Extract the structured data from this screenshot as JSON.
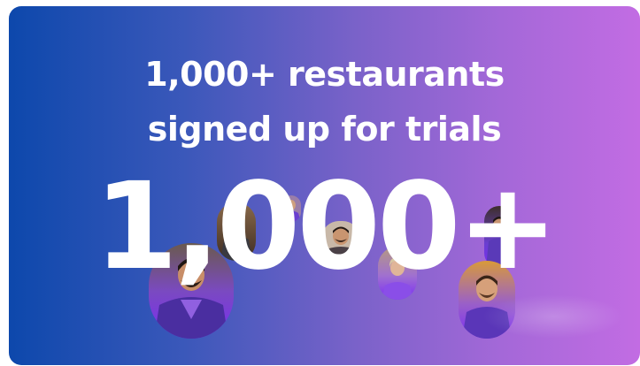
{
  "card": {
    "headline_line1": "1,000+ restaurants",
    "headline_line2": "signed up for trials",
    "big_number": "1,000+"
  },
  "colors": {
    "gradient_start": "#0d48ac",
    "gradient_end": "#c26ce3",
    "text": "#ffffff",
    "photo_tint": "#7a2cf5"
  },
  "photos": [
    {
      "name": "restaurant-owner-photo-1",
      "shape": "oval"
    },
    {
      "name": "restaurant-owner-photo-2",
      "shape": "oval"
    },
    {
      "name": "restaurant-owner-photo-3",
      "shape": "oval"
    },
    {
      "name": "restaurant-owner-photo-4",
      "shape": "circle"
    },
    {
      "name": "restaurant-owner-photo-5",
      "shape": "oval"
    },
    {
      "name": "restaurant-owner-photo-6",
      "shape": "oval"
    },
    {
      "name": "restaurant-owner-photo-7",
      "shape": "oval"
    }
  ]
}
